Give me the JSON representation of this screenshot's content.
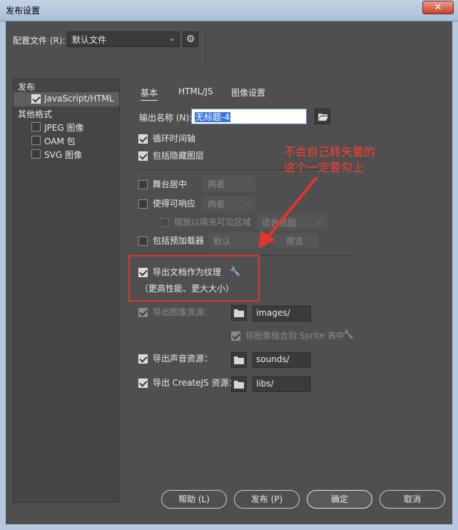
{
  "window": {
    "title": "发布设置",
    "close_glyph": "✕"
  },
  "profile": {
    "label": "配置文件 (R):",
    "value": "默认文件",
    "gear_icon": "gear-icon"
  },
  "sidebar": {
    "publish_header": "发布",
    "javascript_html": {
      "label": "JavaScript/HTML",
      "checked": true
    },
    "other_formats_header": "其他格式",
    "jpeg": {
      "label": "JPEG 图像",
      "checked": false
    },
    "oam": {
      "label": "OAM 包",
      "checked": false
    },
    "svg": {
      "label": "SVG 图像",
      "checked": false
    }
  },
  "tabs": [
    {
      "label": "基本",
      "active": true
    },
    {
      "label": "HTML/JS",
      "active": false
    },
    {
      "label": "图像设置",
      "active": false
    }
  ],
  "output": {
    "label": "输出名称 (N):",
    "value": "无标题-4"
  },
  "options": {
    "loop_timeline": {
      "label": "循环时间轴",
      "checked": true
    },
    "include_hidden_layers": {
      "label": "包括隐藏图层",
      "checked": true
    },
    "center_stage": {
      "label": "舞台居中",
      "checked": false,
      "select_value": "两者"
    },
    "make_responsive": {
      "label": "使得可响应",
      "checked": false,
      "select_value": "两者"
    },
    "scale_to_fill": {
      "label": "缩放以填充可见区域",
      "checked": false,
      "select_value": "适合视图"
    },
    "include_preloader": {
      "label": "包括预加载器",
      "checked": false,
      "select_value": "默认",
      "preview_label": "预览"
    },
    "export_doc_as_texture": {
      "label": "导出文档作为纹理",
      "checked": true,
      "note": "（更高性能、更大大小）",
      "icon": "wrench-icon"
    },
    "export_image_assets": {
      "label": "导出图像资源：",
      "checked": true,
      "enabled": false,
      "path": "images/"
    },
    "combine_into_sprite": {
      "label": "将图像组合到 Sprite 表中",
      "checked": true,
      "enabled": false,
      "icon": "wrench-icon"
    },
    "export_sound_assets": {
      "label": "导出声音资源：",
      "checked": true,
      "path": "sounds/"
    },
    "export_createjs_assets": {
      "label": "导出 CreateJS 资源：",
      "checked": true,
      "path": "libs/"
    }
  },
  "annotation": {
    "line1": "不会自己转矢量的",
    "line2": "这个一定要勾上",
    "color": "#e0362c"
  },
  "buttons": {
    "help": "帮助 (L)",
    "publish": "发布 (P)",
    "ok": "确定",
    "cancel": "取消"
  }
}
